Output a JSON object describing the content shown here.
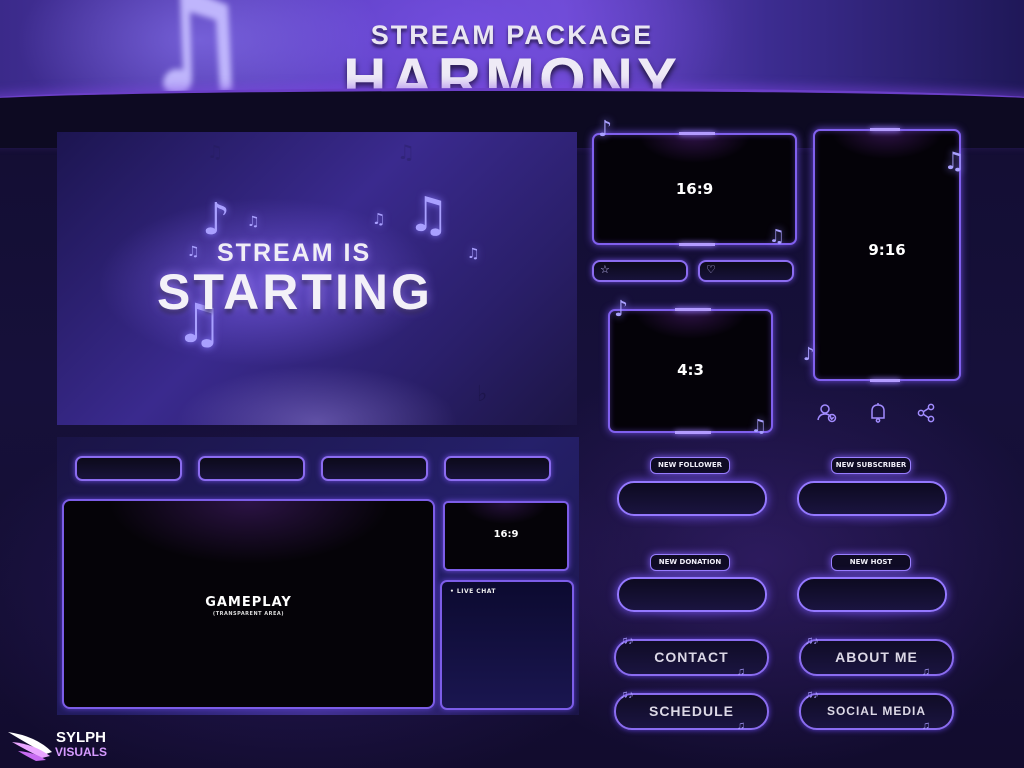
{
  "header": {
    "subtitle": "STREAM PACKAGE",
    "title": "HARMONY"
  },
  "starting_screen": {
    "line1": "STREAM IS",
    "line2": "STARTING"
  },
  "overlay": {
    "top_bar_count": 4,
    "gameplay_title": "GAMEPLAY",
    "gameplay_subtitle": "(TRANSPARENT AREA)",
    "cam_label": "16:9",
    "chat_label": "• LIVE CHAT"
  },
  "webcams": {
    "cam_16_9": "16:9",
    "cam_9_16": "9:16",
    "cam_4_3": "4:3"
  },
  "small_bars": [
    {
      "icon": "star-icon",
      "glyph": "☆"
    },
    {
      "icon": "heart-icon",
      "glyph": "♡"
    }
  ],
  "social_icons": [
    {
      "name": "users-icon"
    },
    {
      "name": "bell-icon"
    },
    {
      "name": "share-icon"
    }
  ],
  "alerts": [
    {
      "label": "NEW FOLLOWER"
    },
    {
      "label": "NEW SUBSCRIBER"
    },
    {
      "label": "NEW DONATION"
    },
    {
      "label": "NEW HOST"
    }
  ],
  "panels": [
    {
      "label": "CONTACT"
    },
    {
      "label": "ABOUT ME"
    },
    {
      "label": "SCHEDULE"
    },
    {
      "label": "SOCIAL MEDIA"
    }
  ],
  "brand": {
    "line1": "SYLPH",
    "line2": "VISUALS"
  },
  "colors": {
    "accent": "#8b6cf0",
    "glow": "#6a4ad8",
    "background": "#120d30",
    "text": "#eeeaf6"
  }
}
